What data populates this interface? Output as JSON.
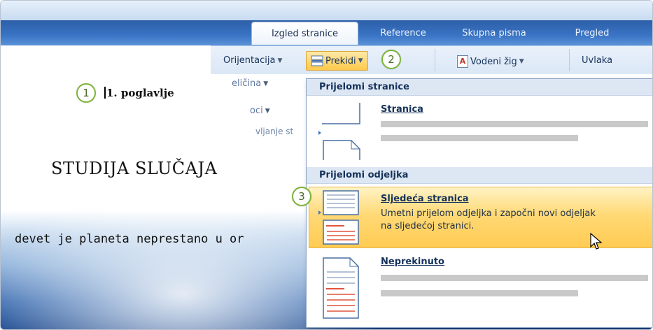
{
  "tabs": [
    {
      "label": "Izgled stranice",
      "active": true
    },
    {
      "label": "Reference"
    },
    {
      "label": "Skupna pisma"
    },
    {
      "label": "Pregled"
    }
  ],
  "ribbon": {
    "orientation": "Orijentacija",
    "size": "eličina",
    "columns": "oci",
    "hyphenation": "vljanje st",
    "breaks": "Prekidi",
    "watermark": "Vodeni žig",
    "indent": "Uvlaka"
  },
  "document": {
    "chapter": "1. poglavlje",
    "heading": "STUDIJA SLUČAJA",
    "body": "devet je planeta neprestano u or"
  },
  "callouts": [
    "1",
    "2",
    "3"
  ],
  "menu": {
    "page_breaks_header": "Prijelomi stranice",
    "page_item_title": "Stranica",
    "section_breaks_header": "Prijelomi odjeljka",
    "next_page_title": "Sljedeća stranica",
    "next_page_desc_1": "Umetni prijelom odjeljka i započni novi odjeljak",
    "next_page_desc_2": "na sljedećoj stranici.",
    "continuous_title": "Neprekinuto"
  },
  "colors": {
    "ribbon_blue": "#3a74c4",
    "menu_highlight": "#ffd976",
    "callout_green": "#7db43a",
    "page_break_marker": "#e2543e"
  }
}
